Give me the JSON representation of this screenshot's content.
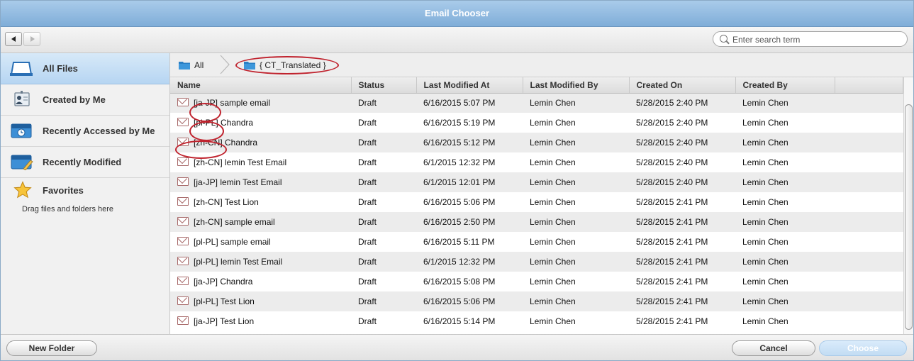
{
  "window": {
    "title": "Email Chooser"
  },
  "toolbar": {
    "search_placeholder": "Enter search term"
  },
  "sidebar": {
    "items": [
      {
        "label": "All Files",
        "icon": "file-icon",
        "active": true
      },
      {
        "label": "Created by Me",
        "icon": "contact-card-icon"
      },
      {
        "label": "Recently Accessed by Me",
        "icon": "calendar-clock-icon"
      },
      {
        "label": "Recently Modified",
        "icon": "calendar-edit-icon"
      }
    ],
    "favorites": {
      "label": "Favorites",
      "icon": "star-icon",
      "hint": "Drag files and folders here"
    }
  },
  "breadcrumb": {
    "root": "All",
    "current": "{ CT_Translated }"
  },
  "table": {
    "columns": [
      "Name",
      "Status",
      "Last Modified At",
      "Last Modified By",
      "Created On",
      "Created By"
    ],
    "rows": [
      [
        "[ja-JP] sample email",
        "Draft",
        "6/16/2015 5:07 PM",
        "Lemin Chen",
        "5/28/2015 2:40 PM",
        "Lemin Chen"
      ],
      [
        "[pl-PL] Chandra",
        "Draft",
        "6/16/2015 5:19 PM",
        "Lemin Chen",
        "5/28/2015 2:40 PM",
        "Lemin Chen"
      ],
      [
        "[zh-CN] Chandra",
        "Draft",
        "6/16/2015 5:12 PM",
        "Lemin Chen",
        "5/28/2015 2:40 PM",
        "Lemin Chen"
      ],
      [
        "[zh-CN] lemin Test Email",
        "Draft",
        "6/1/2015 12:32 PM",
        "Lemin Chen",
        "5/28/2015 2:40 PM",
        "Lemin Chen"
      ],
      [
        "[ja-JP] lemin Test Email",
        "Draft",
        "6/1/2015 12:01 PM",
        "Lemin Chen",
        "5/28/2015 2:40 PM",
        "Lemin Chen"
      ],
      [
        "[zh-CN] Test Lion",
        "Draft",
        "6/16/2015 5:06 PM",
        "Lemin Chen",
        "5/28/2015 2:41 PM",
        "Lemin Chen"
      ],
      [
        "[zh-CN] sample email",
        "Draft",
        "6/16/2015 2:50 PM",
        "Lemin Chen",
        "5/28/2015 2:41 PM",
        "Lemin Chen"
      ],
      [
        "[pl-PL] sample email",
        "Draft",
        "6/16/2015 5:11 PM",
        "Lemin Chen",
        "5/28/2015 2:41 PM",
        "Lemin Chen"
      ],
      [
        "[pl-PL] lemin Test Email",
        "Draft",
        "6/1/2015 12:32 PM",
        "Lemin Chen",
        "5/28/2015 2:41 PM",
        "Lemin Chen"
      ],
      [
        "[ja-JP] Chandra",
        "Draft",
        "6/16/2015 5:08 PM",
        "Lemin Chen",
        "5/28/2015 2:41 PM",
        "Lemin Chen"
      ],
      [
        "[pl-PL] Test Lion",
        "Draft",
        "6/16/2015 5:06 PM",
        "Lemin Chen",
        "5/28/2015 2:41 PM",
        "Lemin Chen"
      ],
      [
        "[ja-JP] Test Lion",
        "Draft",
        "6/16/2015 5:14 PM",
        "Lemin Chen",
        "5/28/2015 2:41 PM",
        "Lemin Chen"
      ]
    ]
  },
  "footer": {
    "new_folder": "New Folder",
    "cancel": "Cancel",
    "choose": "Choose"
  },
  "colors": {
    "title_bar": "#8fb9e0",
    "annotation": "#c0232e",
    "active_item": "#c5def4"
  }
}
